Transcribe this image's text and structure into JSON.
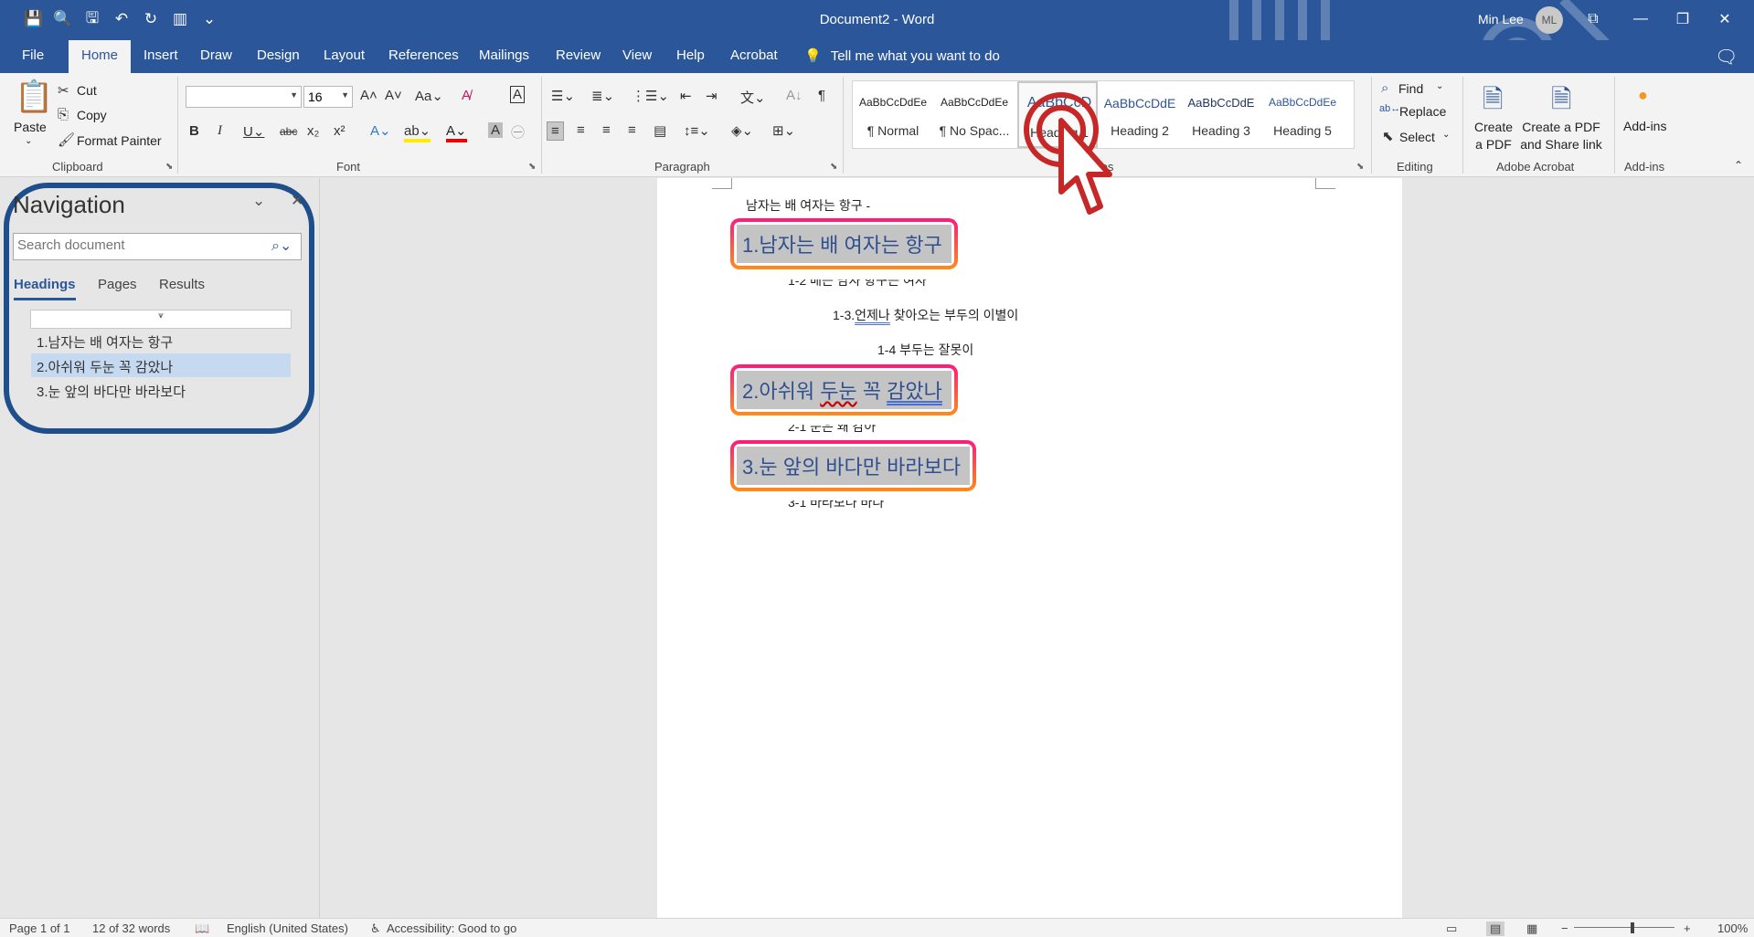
{
  "window": {
    "title": "Document2  -  Word",
    "user_name": "Min Lee",
    "user_initials": "ML",
    "minimize": "—",
    "restore": "❐",
    "close": "✕"
  },
  "tabs": [
    "File",
    "Home",
    "Insert",
    "Draw",
    "Design",
    "Layout",
    "References",
    "Mailings",
    "Review",
    "View",
    "Help",
    "Acrobat"
  ],
  "tell_me": "Tell me what you want to do",
  "ribbon": {
    "clipboard": {
      "paste": "Paste",
      "cut": "Cut",
      "copy": "Copy",
      "format_painter": "Format Painter",
      "label": "Clipboard"
    },
    "font": {
      "font_name": "",
      "font_size": "16",
      "label": "Font"
    },
    "paragraph": {
      "label": "Paragraph"
    },
    "styles": {
      "label": "Styles",
      "items": [
        {
          "sample": "AaBbCcDdEe",
          "name": "¶ Normal"
        },
        {
          "sample": "AaBbCcDdEe",
          "name": "¶ No Spac..."
        },
        {
          "sample": "AaBbCcD",
          "name": "Heading 1"
        },
        {
          "sample": "AaBbCcDdE",
          "name": "Heading 2"
        },
        {
          "sample": "AaBbCcDdE",
          "name": "Heading 3"
        },
        {
          "sample": "AaBbCcDdEe",
          "name": "Heading 5"
        }
      ]
    },
    "editing": {
      "find": "Find",
      "replace": "Replace",
      "select": "Select",
      "label": "Editing"
    },
    "acrobat": {
      "create_pdf_1": "Create",
      "create_pdf_2": "a PDF",
      "share_1": "Create a PDF",
      "share_2": "and Share link",
      "label": "Adobe Acrobat"
    },
    "addins": {
      "button": "Add-ins",
      "label": "Add-ins"
    }
  },
  "navigation": {
    "title": "Navigation",
    "search_placeholder": "Search document",
    "tabs": [
      "Headings",
      "Pages",
      "Results"
    ],
    "headings": [
      {
        "text": "1.남자는 배 여자는 항구",
        "selected": false
      },
      {
        "text": "2.아쉬워 두눈 꼭 감았나",
        "selected": true
      },
      {
        "text": "3.눈 앞의 바다만 바라보다",
        "selected": false
      }
    ]
  },
  "document": {
    "line_intro": "남자는 배 여자는 항구 -",
    "h1": "1.남자는 배 여자는 항구",
    "l_1_2": "1-2 배는 남자 항구는 여자",
    "l_1_3_a": "1-3.",
    "l_1_3_b": "언제나",
    "l_1_3_c": " 찾아오는 부두의 이별이",
    "l_1_4": "1-4 부두는 잘못이",
    "h2_a": "2.아쉬워 ",
    "h2_b": "두눈",
    "h2_c": " 꼭 ",
    "h2_d": "감았나",
    "l_2_1": "2-1 눈은 왜 감아",
    "h3": "3.눈 앞의 바다만 바라보다",
    "l_3_1": "3-1 바라보나 바나"
  },
  "status": {
    "page": "Page 1 of 1",
    "words": "12 of 32 words",
    "language": "English (United States)",
    "accessibility": "Accessibility: Good to go",
    "zoom": "100%"
  },
  "colors": {
    "accent": "#2b579a",
    "highlight_start": "#ff1a7a",
    "highlight_end": "#ff8c1a",
    "cursor": "#c62828"
  }
}
